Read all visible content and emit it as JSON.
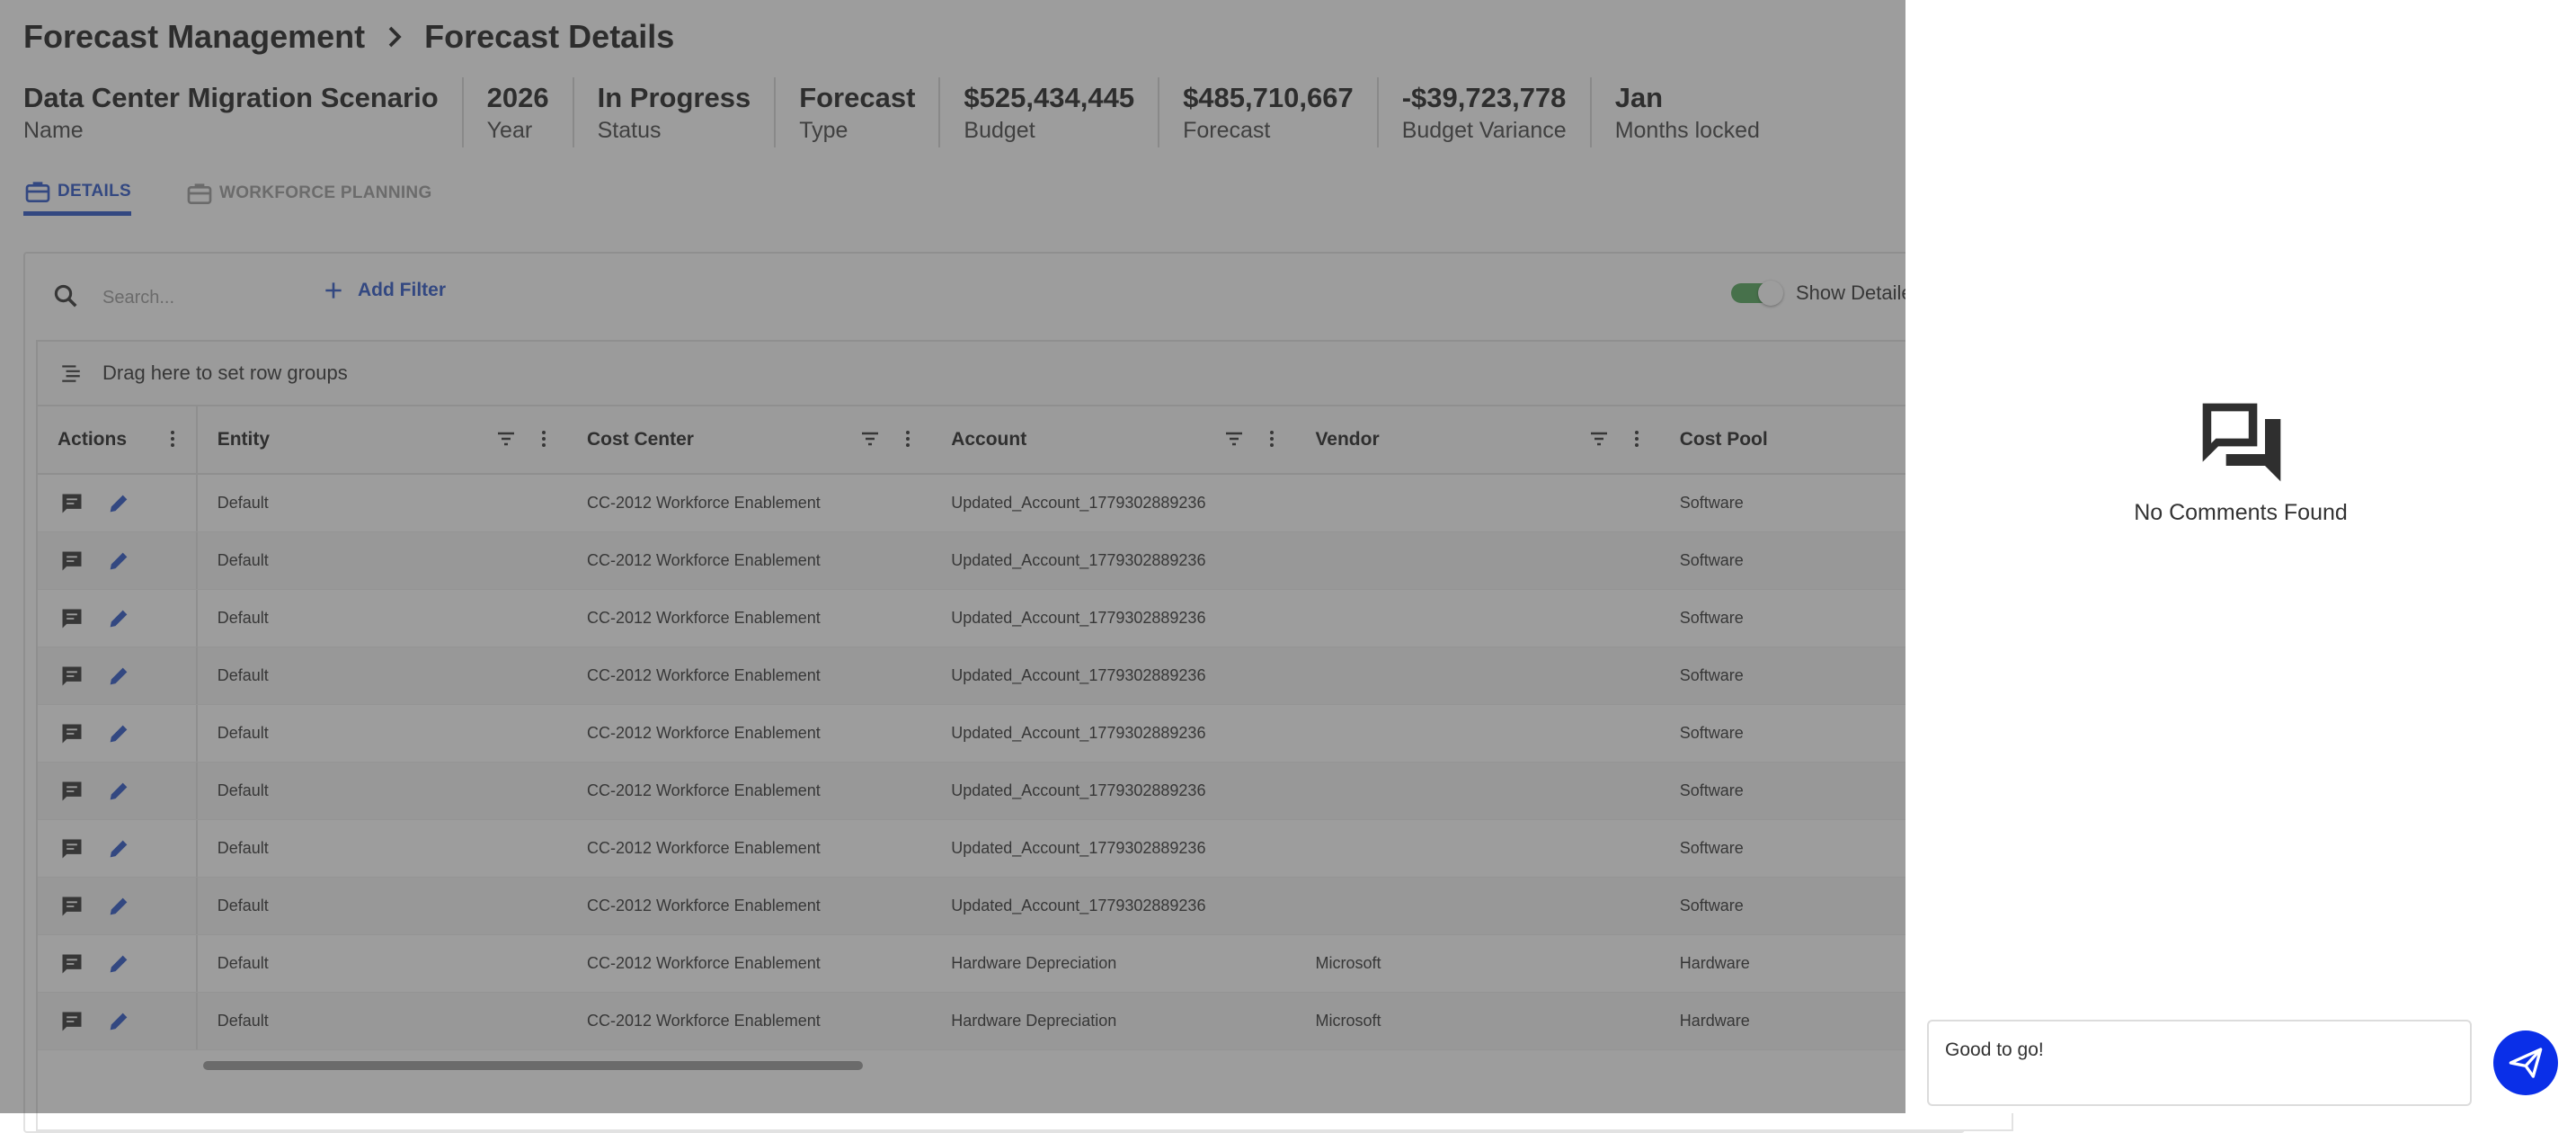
{
  "breadcrumb": {
    "parent": "Forecast Management",
    "current": "Forecast Details"
  },
  "summary": [
    {
      "value": "Data Center Migration Scenario",
      "label": "Name"
    },
    {
      "value": "2026",
      "label": "Year"
    },
    {
      "value": "In Progress",
      "label": "Status"
    },
    {
      "value": "Forecast",
      "label": "Type"
    },
    {
      "value": "$525,434,445",
      "label": "Budget"
    },
    {
      "value": "$485,710,667",
      "label": "Forecast"
    },
    {
      "value": "-$39,723,778",
      "label": "Budget Variance"
    },
    {
      "value": "Jan",
      "label": "Months locked"
    }
  ],
  "tabs": {
    "details": "DETAILS",
    "workforce": "WORKFORCE PLANNING"
  },
  "toolbar": {
    "search_placeholder": "Search...",
    "add_filter": "Add Filter",
    "toggle_label": "Show Detailed"
  },
  "grid": {
    "group_bar": "Drag here to set row groups",
    "columns": {
      "actions": "Actions",
      "entity": "Entity",
      "cost_center": "Cost Center",
      "account": "Account",
      "vendor": "Vendor",
      "cost_pool": "Cost Pool"
    },
    "rows": [
      {
        "entity": "Default",
        "cost_center": "CC-2012 Workforce Enablement",
        "account": "Updated_Account_1779302889236",
        "vendor": "",
        "cost_pool": "Software"
      },
      {
        "entity": "Default",
        "cost_center": "CC-2012 Workforce Enablement",
        "account": "Updated_Account_1779302889236",
        "vendor": "",
        "cost_pool": "Software"
      },
      {
        "entity": "Default",
        "cost_center": "CC-2012 Workforce Enablement",
        "account": "Updated_Account_1779302889236",
        "vendor": "",
        "cost_pool": "Software"
      },
      {
        "entity": "Default",
        "cost_center": "CC-2012 Workforce Enablement",
        "account": "Updated_Account_1779302889236",
        "vendor": "",
        "cost_pool": "Software"
      },
      {
        "entity": "Default",
        "cost_center": "CC-2012 Workforce Enablement",
        "account": "Updated_Account_1779302889236",
        "vendor": "",
        "cost_pool": "Software"
      },
      {
        "entity": "Default",
        "cost_center": "CC-2012 Workforce Enablement",
        "account": "Updated_Account_1779302889236",
        "vendor": "",
        "cost_pool": "Software"
      },
      {
        "entity": "Default",
        "cost_center": "CC-2012 Workforce Enablement",
        "account": "Updated_Account_1779302889236",
        "vendor": "",
        "cost_pool": "Software"
      },
      {
        "entity": "Default",
        "cost_center": "CC-2012 Workforce Enablement",
        "account": "Updated_Account_1779302889236",
        "vendor": "",
        "cost_pool": "Software"
      },
      {
        "entity": "Default",
        "cost_center": "CC-2012 Workforce Enablement",
        "account": "Hardware Depreciation",
        "vendor": "Microsoft",
        "cost_pool": "Hardware"
      },
      {
        "entity": "Default",
        "cost_center": "CC-2012 Workforce Enablement",
        "account": "Hardware Depreciation",
        "vendor": "Microsoft",
        "cost_pool": "Hardware"
      }
    ]
  },
  "drawer": {
    "empty_text": "No Comments Found",
    "comment_value": "Good to go!"
  },
  "colors": {
    "accent": "#2b55c6",
    "send": "#0a2fe8",
    "toggle_on": "#52a75a"
  }
}
